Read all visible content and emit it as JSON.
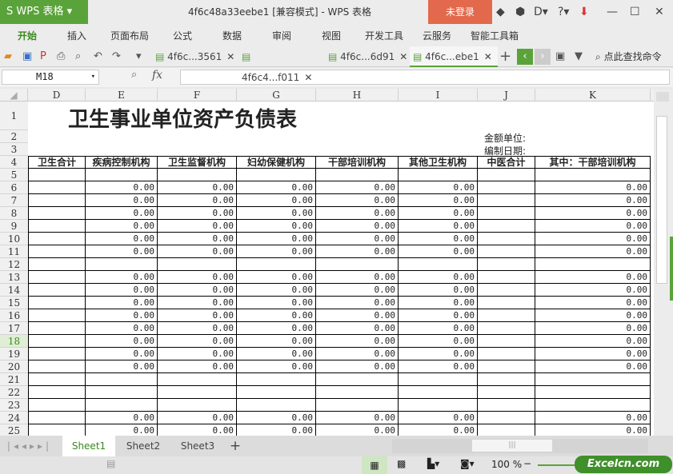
{
  "app": {
    "logo": "S WPS 表格",
    "title": "4f6c48a33eebe1 [兼容模式] - WPS 表格",
    "login": "未登录"
  },
  "menu": [
    "开始",
    "插入",
    "页面布局",
    "公式",
    "数据",
    "审阅",
    "视图",
    "开发工具",
    "云服务",
    "智能工具箱"
  ],
  "doc_tabs": [
    {
      "label": "4f6c...3561"
    },
    {
      "label": "4f6c4...f011"
    },
    {
      "label": "4f6c...6d91"
    },
    {
      "label": "4f6c...ebe1",
      "active": true
    }
  ],
  "search_cmd": "点此查找命令",
  "namebox": "M18",
  "fx": "fx",
  "columns": [
    "D",
    "E",
    "F",
    "G",
    "H",
    "I",
    "J",
    "K"
  ],
  "sheet": {
    "title": "卫生事业单位资产负债表",
    "unit_label": "金额单位:",
    "date_label": "编制日期:",
    "headers": [
      "卫生合计",
      "疾病控制机构",
      "卫生监督机构",
      "妇幼保健机构",
      "干部培训机构",
      "其他卫生机构",
      "中医合计",
      "其中：干部培训机构"
    ],
    "zero": "0.00",
    "row_numbers": [
      "1",
      "2",
      "3",
      "4",
      "5",
      "6",
      "7",
      "8",
      "9",
      "10",
      "11",
      "12",
      "13",
      "14",
      "15",
      "16",
      "17",
      "18",
      "19",
      "20",
      "21",
      "22",
      "23",
      "24",
      "25"
    ],
    "value_rows": [
      "6",
      "7",
      "8",
      "9",
      "10",
      "11",
      "13",
      "14",
      "15",
      "16",
      "17",
      "18",
      "19",
      "20",
      "24",
      "25"
    ]
  },
  "sheets": [
    "Sheet1",
    "Sheet2",
    "Sheet3"
  ],
  "status": {
    "zoom": "100 %",
    "watermark": "Excelcn.com"
  },
  "colors": {
    "accent": "#5aa33a",
    "login": "#e2694c"
  }
}
